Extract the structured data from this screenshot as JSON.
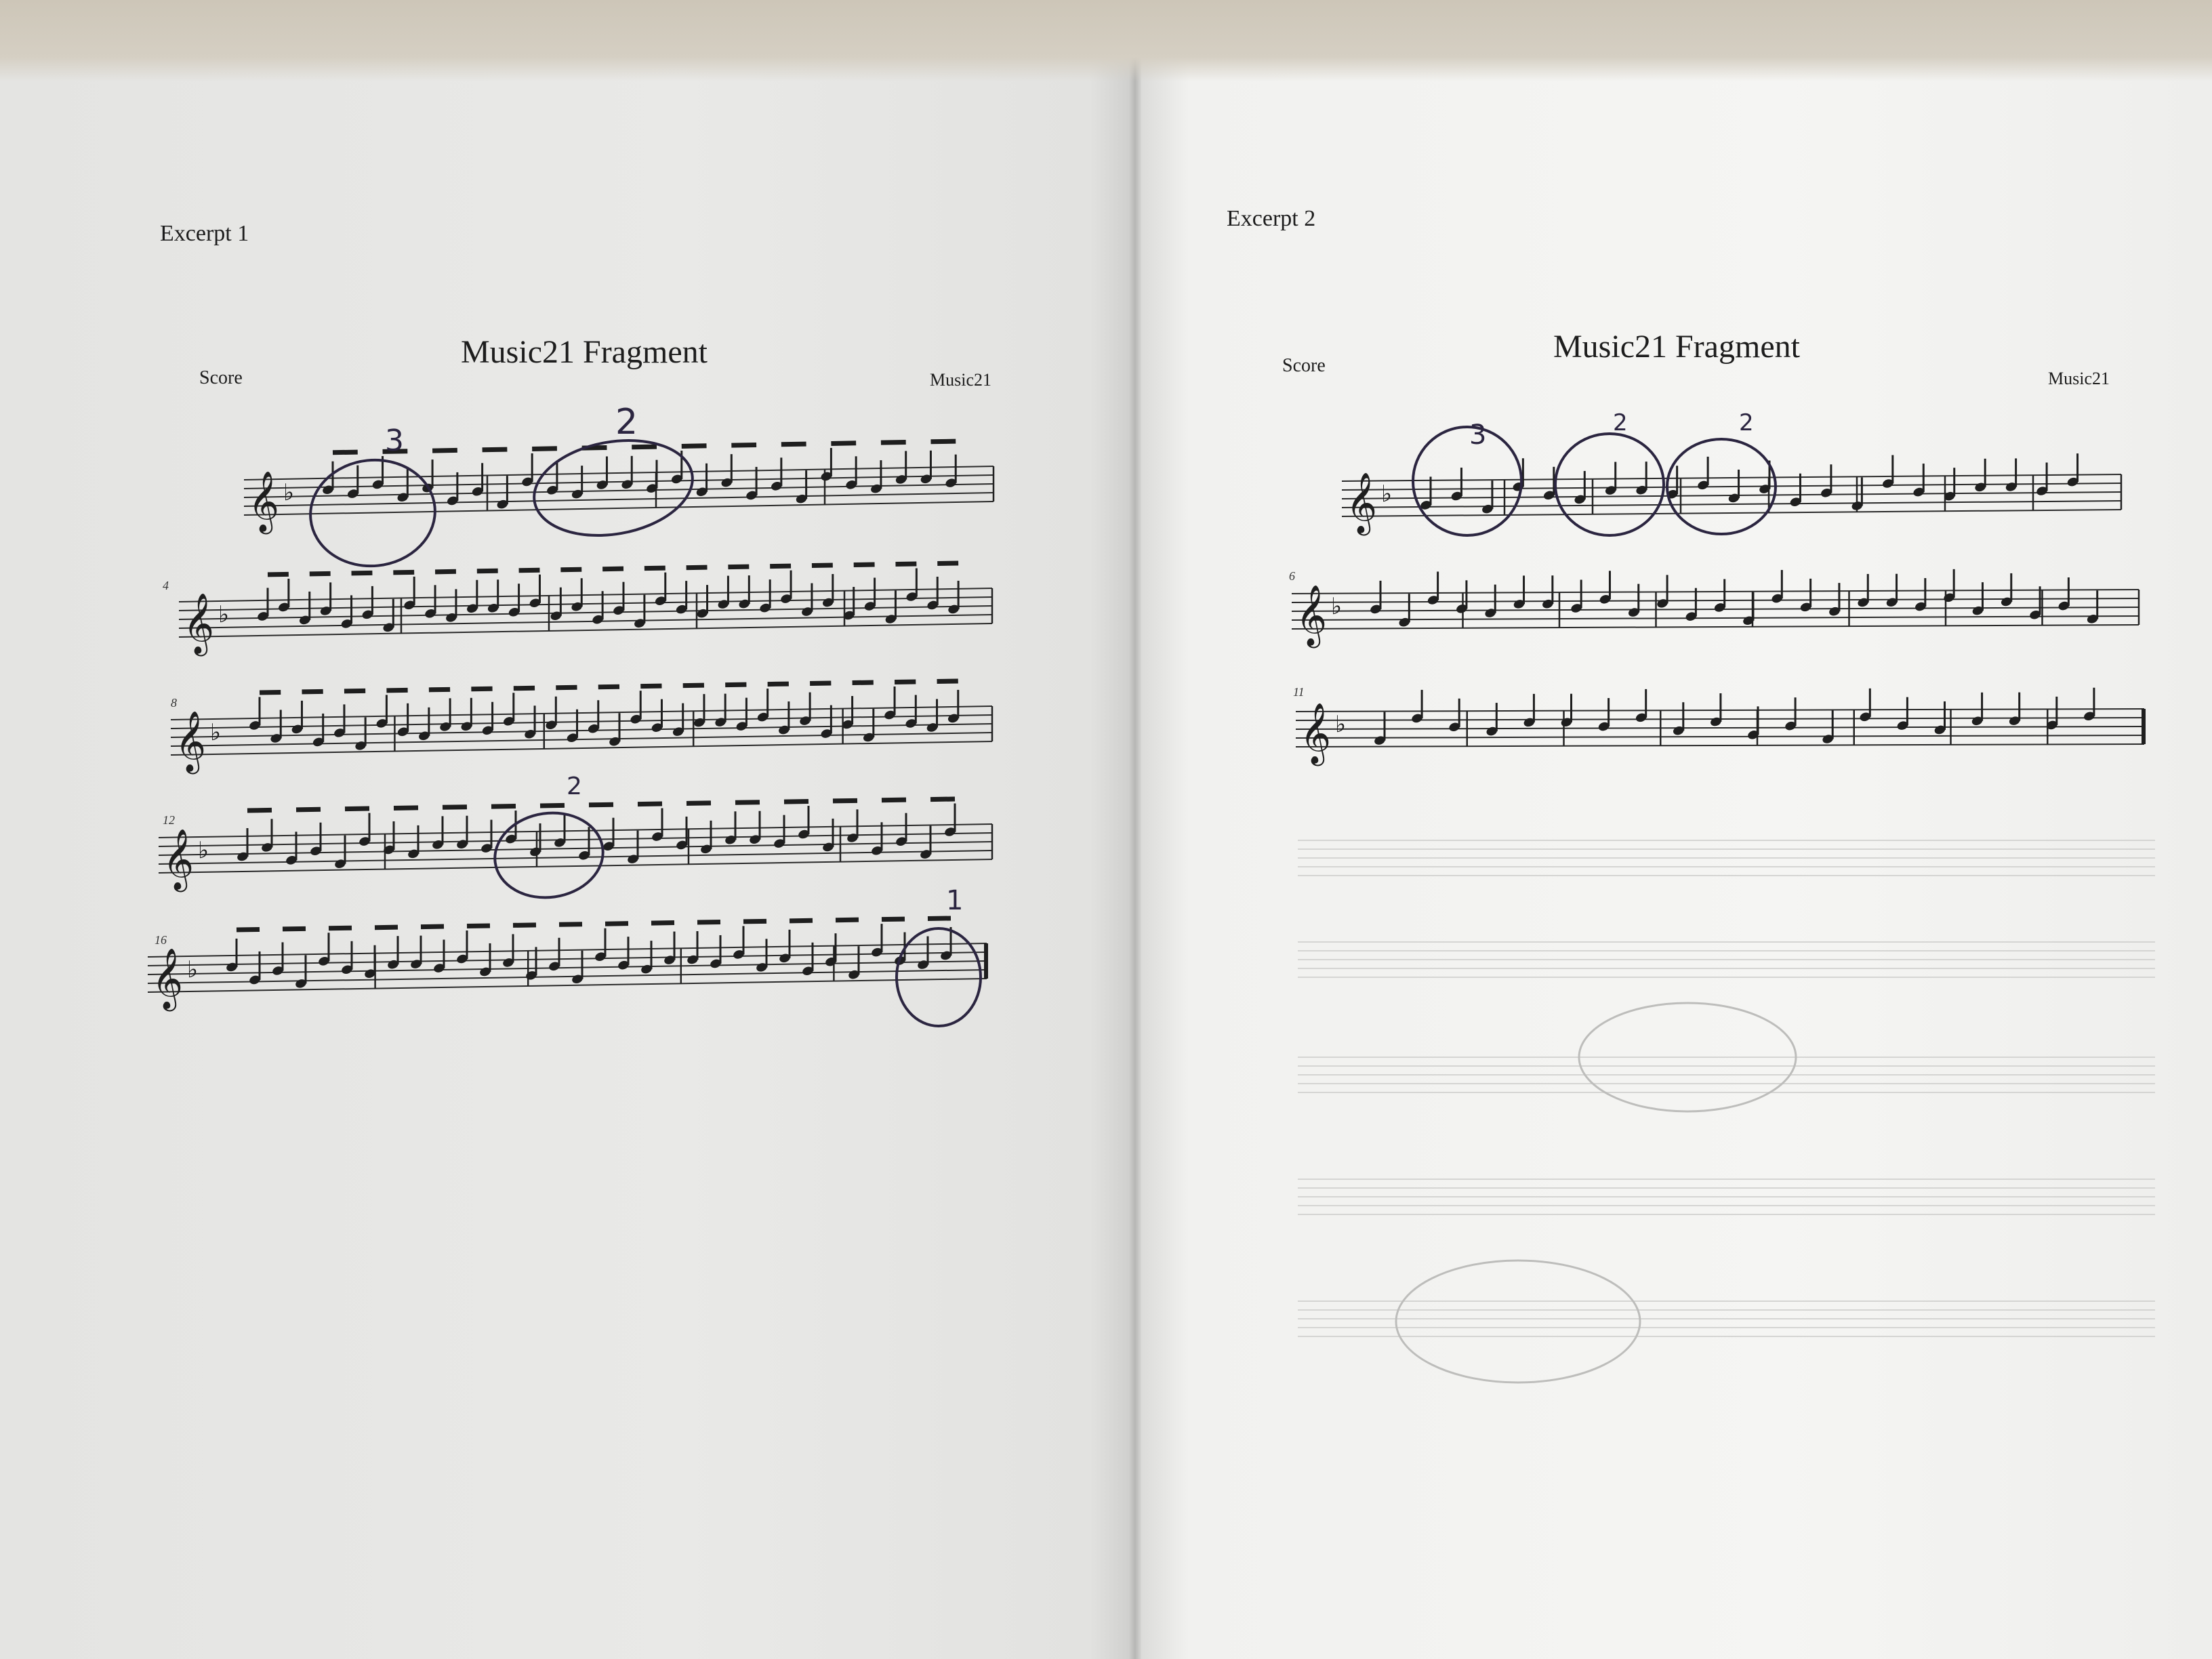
{
  "left_page": {
    "excerpt_label": "Excerpt 1",
    "score_label": "Score",
    "title": "Music21 Fragment",
    "composer": "Music21",
    "measure_numbers": [
      "4",
      "8",
      "12",
      "16"
    ],
    "annotations": [
      "3",
      "2",
      "2",
      "1"
    ]
  },
  "right_page": {
    "excerpt_label": "Excerpt 2",
    "score_label": "Score",
    "title": "Music21 Fragment",
    "composer": "Music21",
    "measure_numbers": [
      "6",
      "11"
    ],
    "annotations": [
      "3",
      "2",
      "2"
    ]
  },
  "colors": {
    "paper": "#e9e9e7",
    "ink": "#1e1e1e",
    "pen": "#2b2540",
    "desk": "#cfc9bd"
  }
}
